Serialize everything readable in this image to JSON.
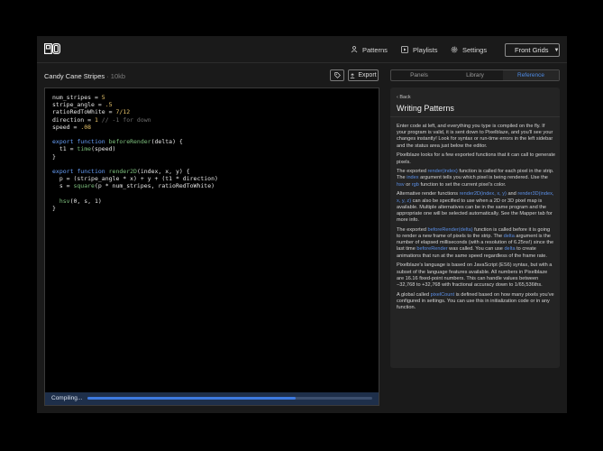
{
  "app": {
    "logo_name": "pixelblaze-logo",
    "nav": [
      {
        "label": "Patterns",
        "icon": "patterns-icon"
      },
      {
        "label": "Playlists",
        "icon": "playlist-icon"
      },
      {
        "label": "Settings",
        "icon": "gear-icon"
      }
    ],
    "device_select": {
      "value": "Front Grids",
      "icon": "device-icon"
    }
  },
  "file": {
    "name": "Candy Cane Stripes",
    "size": "· 10kb",
    "export_label": "Export"
  },
  "code_lines": [
    [
      {
        "t": "num_stripes = "
      },
      {
        "t": "5",
        "c": "num"
      }
    ],
    [
      {
        "t": "stripe_angle = "
      },
      {
        "t": ".5",
        "c": "num"
      }
    ],
    [
      {
        "t": "ratioRedToWhite = "
      },
      {
        "t": "7/12",
        "c": "num"
      }
    ],
    [
      {
        "t": "direction = "
      },
      {
        "t": "1",
        "c": "num"
      },
      {
        "t": " // -1 for down",
        "c": "cm"
      }
    ],
    [
      {
        "t": "speed = "
      },
      {
        "t": ".08",
        "c": "num"
      }
    ],
    [
      {
        "t": ""
      }
    ],
    [
      {
        "t": "export function ",
        "c": "kw"
      },
      {
        "t": "beforeRender",
        "c": "fn"
      },
      {
        "t": "(delta) {"
      }
    ],
    [
      {
        "t": "  t1 = "
      },
      {
        "t": "time",
        "c": "fn"
      },
      {
        "t": "(speed)"
      }
    ],
    [
      {
        "t": "}"
      }
    ],
    [
      {
        "t": ""
      }
    ],
    [
      {
        "t": "export function ",
        "c": "kw"
      },
      {
        "t": "render2D",
        "c": "fn"
      },
      {
        "t": "(index, x, y) {"
      }
    ],
    [
      {
        "t": "  p = (stripe_angle * x) + y + (t1 * direction)"
      }
    ],
    [
      {
        "t": "  s = "
      },
      {
        "t": "square",
        "c": "fn"
      },
      {
        "t": "(p * num_stripes, ratioRedToWhite)"
      }
    ],
    [
      {
        "t": ""
      }
    ],
    [
      {
        "t": "  "
      },
      {
        "t": "hsv",
        "c": "fn"
      },
      {
        "t": "(0, s, 1)"
      }
    ],
    [
      {
        "t": "}"
      }
    ]
  ],
  "status": {
    "label": "Compiling...",
    "progress": 0.73
  },
  "tabs": [
    {
      "label": "Panels",
      "active": false
    },
    {
      "label": "Library",
      "active": false
    },
    {
      "label": "Reference",
      "active": true
    }
  ],
  "reference": {
    "back_label": "Back",
    "title": "Writing Patterns",
    "paragraphs": [
      [
        {
          "t": "Enter code at left, and everything you type is compiled on the fly. If your program is valid, it is sent down to Pixelblaze, and you'll see your changes instantly! Look for syntax or run-time errors in the left sidebar and the status area just below the editor."
        }
      ],
      [
        {
          "t": "Pixelblaze looks for a few exported functions that it can call to generate pixels."
        }
      ],
      [
        {
          "t": "The exported "
        },
        {
          "t": "render(index)",
          "c": "hl"
        },
        {
          "t": " function is called for each pixel in the strip. The "
        },
        {
          "t": "index",
          "c": "hl"
        },
        {
          "t": " argument tells you which pixel is being rendered. Use the "
        },
        {
          "t": "hsv",
          "c": "hl"
        },
        {
          "t": " or "
        },
        {
          "t": "rgb",
          "c": "hl"
        },
        {
          "t": " function to set the current pixel's color."
        }
      ],
      [
        {
          "t": "Alternative render functions "
        },
        {
          "t": "render2D(index, x, y)",
          "c": "hl"
        },
        {
          "t": " and "
        },
        {
          "t": "render3D(index, x, y, z)",
          "c": "hl"
        },
        {
          "t": " can also be specified to use when a 2D or 3D pixel map is available. Multiple alternatives can be in the same program and the appropriate one will be selected automatically. See the Mapper tab for more info."
        }
      ],
      [
        {
          "t": "The exported "
        },
        {
          "t": "beforeRender(delta)",
          "c": "hl"
        },
        {
          "t": " function is called before it is going to render a new frame of pixels to the strip. The "
        },
        {
          "t": "delta",
          "c": "hl"
        },
        {
          "t": " argument is the number of elapsed milliseconds (with a resolution of 6.25ns!) since the last time "
        },
        {
          "t": "beforeRender",
          "c": "hl"
        },
        {
          "t": " was called. You can use "
        },
        {
          "t": "delta",
          "c": "hl"
        },
        {
          "t": " to create animations that run at the same speed regardless of the frame rate."
        }
      ],
      [
        {
          "t": "Pixelblaze's language is based on JavaScript (ES6) syntax, but with a subset of the language features available. All numbers in Pixelblaze are 16.16 fixed-point numbers. This can handle values between −32,768 to +32,768 with fractional accuracy down to 1/65,536ths."
        }
      ],
      [
        {
          "t": "A global called "
        },
        {
          "t": "pixelCount",
          "c": "hl"
        },
        {
          "t": " is defined based on how many pixels you've configured in settings. You can use this in initialization code or in any function."
        }
      ]
    ]
  }
}
